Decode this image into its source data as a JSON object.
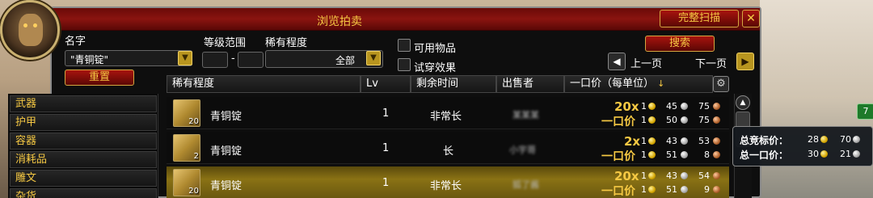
{
  "window": {
    "title": "浏览拍卖",
    "full_scan_label": "完整扫描",
    "close": "✕"
  },
  "filters": {
    "name_label": "名字",
    "name_value": "\"青铜锭\"",
    "level_label": "等级范围",
    "level_sep": "-",
    "rarity_label": "稀有程度",
    "rarity_value": "全部",
    "usable_label": "可用物品",
    "preview_label": "试穿效果",
    "search_label": "搜索",
    "reset_label": "重置",
    "prev_label": "上一页",
    "next_label": "下一页"
  },
  "columns": {
    "rarity": "稀有程度",
    "lv": "Lv",
    "time": "剩余时间",
    "seller": "出售者",
    "buyout": "一口价（每单位）",
    "sort": "↓"
  },
  "categories": [
    "武器",
    "护甲",
    "容器",
    "消耗品",
    "雕文",
    "杂货"
  ],
  "rows": [
    {
      "name": "青铜锭",
      "stack": "20",
      "lv": "1",
      "time": "非常长",
      "seller": "某某某",
      "qty": "20x",
      "bid": {
        "g": "1",
        "s": "45",
        "c": "75"
      },
      "buyout_label": "一口价",
      "buyout": {
        "g": "1",
        "s": "50",
        "c": "75"
      }
    },
    {
      "name": "青铜锭",
      "stack": "2",
      "lv": "1",
      "time": "长",
      "seller": "小宇哥",
      "qty": "2x",
      "bid": {
        "g": "1",
        "s": "43",
        "c": "53"
      },
      "buyout_label": "一口价",
      "buyout": {
        "g": "1",
        "s": "51",
        "c": "8"
      }
    },
    {
      "name": "青铜锭",
      "stack": "20",
      "lv": "1",
      "time": "非常长",
      "seller": "狐了酱",
      "qty": "20x",
      "bid": {
        "g": "1",
        "s": "43",
        "c": "54"
      },
      "buyout_label": "一口价",
      "buyout": {
        "g": "1",
        "s": "51",
        "c": "9"
      }
    }
  ],
  "tooltip": {
    "total_bid_label": "总竞标价：",
    "total_bid": {
      "g": "28",
      "s": "70"
    },
    "total_buyout_label": "总一口价：",
    "total_buyout": {
      "g": "30",
      "s": "21"
    }
  },
  "badge": "7"
}
